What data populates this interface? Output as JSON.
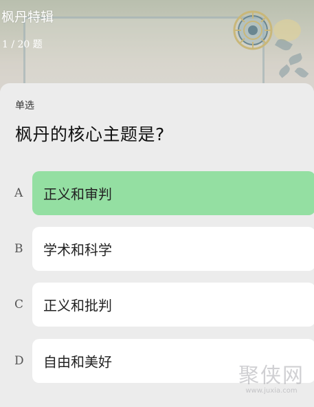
{
  "header": {
    "title": "枫丹特辑",
    "progress": "1 / 20 题"
  },
  "question": {
    "type": "单选",
    "text": "枫丹的核心主题是?"
  },
  "options": [
    {
      "letter": "A",
      "text": "正义和审判",
      "selected": true
    },
    {
      "letter": "B",
      "text": "学术和科学",
      "selected": false
    },
    {
      "letter": "C",
      "text": "正义和批判",
      "selected": false
    },
    {
      "letter": "D",
      "text": "自由和美好",
      "selected": false
    }
  ],
  "colors": {
    "selected_option": "#94dfa2",
    "option_card": "#ffffff",
    "sheet_background": "#ececec"
  },
  "watermark": {
    "brand": "聚侠网",
    "url": "www.juxia.com"
  }
}
